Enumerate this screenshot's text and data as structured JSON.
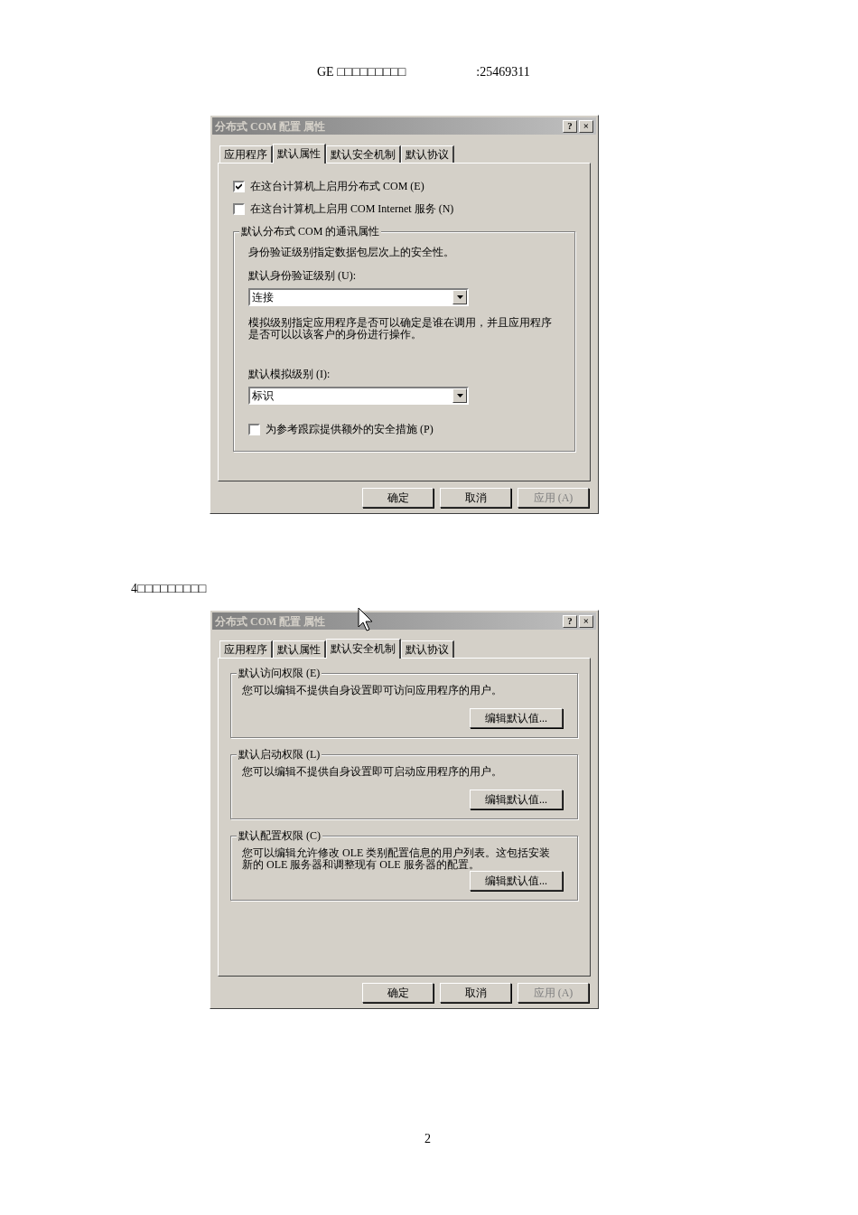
{
  "header": {
    "left": "GE □□□□□□□□□",
    "right": ":25469311"
  },
  "dialogs": [
    {
      "title": "分布式 COM 配置 属性",
      "title_buttons": [
        "?",
        "×"
      ],
      "pointer_visible": false,
      "tabs": [
        {
          "label": "应用程序",
          "selected": false
        },
        {
          "label": "默认属性",
          "selected": true
        },
        {
          "label": "默认安全机制",
          "selected": false
        },
        {
          "label": "默认协议",
          "selected": false
        }
      ],
      "panel": {
        "kind": "general",
        "checkboxes": [
          {
            "label": "在这台计算机上启用分布式 COM (E)",
            "checked": true
          },
          {
            "label": "在这台计算机上启用 COM Internet 服务 (N)",
            "checked": false
          }
        ],
        "group": {
          "title": "默认分布式 COM 的通讯属性",
          "items": [
            {
              "kind": "text",
              "text": "身份验证级别指定数据包层次上的安全性。"
            },
            {
              "kind": "dropdown",
              "label": "默认身份验证级别 (U):",
              "value": "连接"
            },
            {
              "kind": "text",
              "text": "模拟级别指定应用程序是否可以确定是谁在调用，并且应用程序是否可以以该客户的身份进行操作。"
            },
            {
              "kind": "dropdown",
              "label": "默认模拟级别 (I):",
              "value": "标识"
            },
            {
              "kind": "checkbox",
              "label": "为参考跟踪提供额外的安全措施 (P)",
              "checked": false
            }
          ]
        }
      },
      "buttons": [
        {
          "label": "确定",
          "disabled": false
        },
        {
          "label": "取消",
          "disabled": false
        },
        {
          "label": "应用 (A)",
          "disabled": true
        }
      ]
    },
    {
      "title": "分布式 COM 配置 属性",
      "title_buttons": [
        "?",
        "×"
      ],
      "pointer_visible": true,
      "tabs": [
        {
          "label": "应用程序",
          "selected": false
        },
        {
          "label": "默认属性",
          "selected": false
        },
        {
          "label": "默认安全机制",
          "selected": true
        },
        {
          "label": "默认协议",
          "selected": false
        }
      ],
      "panel": {
        "kind": "security",
        "groups": [
          {
            "title": "默认访问权限 (E)",
            "text": "您可以编辑不提供自身设置即可访问应用程序的用户。",
            "button": "编辑默认值..."
          },
          {
            "title": "默认启动权限 (L)",
            "text": "您可以编辑不提供自身设置即可启动应用程序的用户。",
            "button": "编辑默认值..."
          },
          {
            "title": "默认配置权限 (C)",
            "text": "您可以编辑允许修改 OLE 类别配置信息的用户列表。这包括安装新的 OLE 服务器和调整现有 OLE 服务器的配置。",
            "button": "编辑默认值..."
          }
        ]
      },
      "buttons": [
        {
          "label": "确定",
          "disabled": false
        },
        {
          "label": "取消",
          "disabled": false
        },
        {
          "label": "应用 (A)",
          "disabled": true
        }
      ]
    }
  ],
  "section_heading": "4□□□□□□□□□",
  "page_number": "2"
}
